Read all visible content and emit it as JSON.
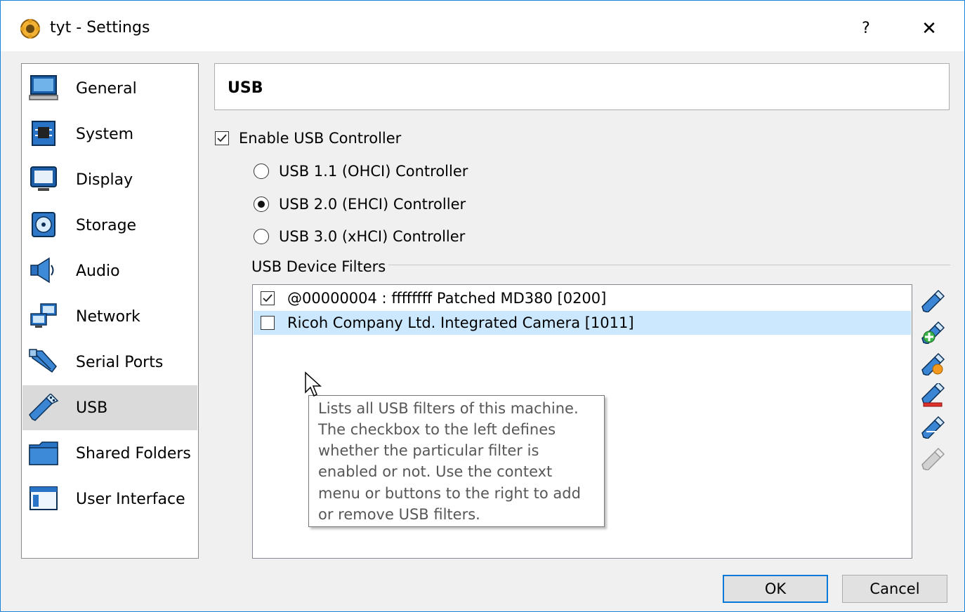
{
  "window": {
    "title": "tyt - Settings",
    "help_label": "?",
    "close_label": "✕"
  },
  "sidebar": {
    "items": [
      {
        "label": "General",
        "icon": "general-icon"
      },
      {
        "label": "System",
        "icon": "system-icon"
      },
      {
        "label": "Display",
        "icon": "display-icon"
      },
      {
        "label": "Storage",
        "icon": "storage-icon"
      },
      {
        "label": "Audio",
        "icon": "audio-icon"
      },
      {
        "label": "Network",
        "icon": "network-icon"
      },
      {
        "label": "Serial Ports",
        "icon": "serial-ports-icon"
      },
      {
        "label": "USB",
        "icon": "usb-icon",
        "selected": true
      },
      {
        "label": "Shared Folders",
        "icon": "shared-folders-icon"
      },
      {
        "label": "User Interface",
        "icon": "user-interface-icon"
      }
    ]
  },
  "main": {
    "header": "USB",
    "enable_usb": {
      "label": "Enable USB Controller",
      "checked": true
    },
    "controllers": [
      {
        "label": "USB 1.1 (OHCI) Controller",
        "selected": false
      },
      {
        "label": "USB 2.0 (EHCI) Controller",
        "selected": true
      },
      {
        "label": "USB 3.0 (xHCI) Controller",
        "selected": false
      }
    ],
    "filters_group_label": "USB Device Filters",
    "filters": [
      {
        "label": "@00000004 : ffffffff Patched MD380 [0200]",
        "checked": true
      },
      {
        "label": "Ricoh Company Ltd. Integrated Camera [1011]",
        "checked": false,
        "highlighted": true
      }
    ],
    "tool_buttons": [
      "add-empty-filter-icon",
      "add-filter-from-device-icon",
      "edit-filter-icon",
      "remove-filter-icon",
      "move-filter-up-icon",
      "move-filter-down-icon"
    ],
    "tooltip_lines": [
      "Lists all USB filters of this machine.",
      "The checkbox to the left defines",
      "whether the particular filter is",
      "enabled or not. Use the context",
      "menu or buttons to the right to add",
      "or remove USB filters."
    ]
  },
  "buttons": {
    "ok": "OK",
    "cancel": "Cancel"
  }
}
